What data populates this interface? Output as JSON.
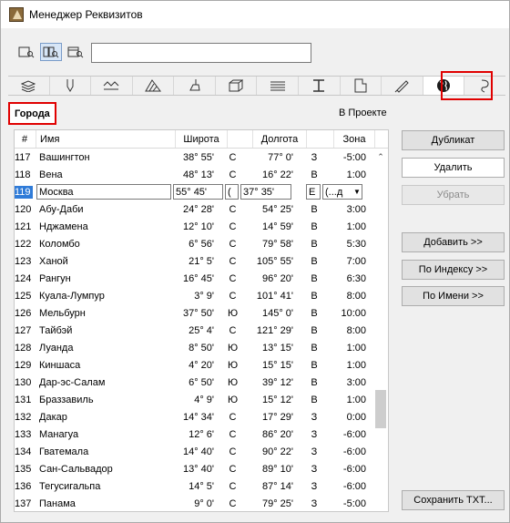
{
  "window": {
    "title": "Менеджер Реквизитов"
  },
  "search": {
    "value": "",
    "placeholder": ""
  },
  "view_buttons": [
    "list-view-icon",
    "grid-view-icon",
    "preview-view-icon"
  ],
  "tabs": [
    {
      "icon": "layers-icon"
    },
    {
      "icon": "pen-icon"
    },
    {
      "icon": "line-type-icon"
    },
    {
      "icon": "fill-icon"
    },
    {
      "icon": "brush-icon"
    },
    {
      "icon": "building-material-icon"
    },
    {
      "icon": "profile-icon"
    },
    {
      "icon": "beam-icon"
    },
    {
      "icon": "zone-category-icon"
    },
    {
      "icon": "pen-set-icon"
    },
    {
      "icon": "globe-icon"
    },
    {
      "icon": "mep-icon"
    }
  ],
  "section": {
    "title": "Города",
    "status": "В Проекте"
  },
  "table": {
    "headers": {
      "num": "#",
      "name": "Имя",
      "lat": "Широта",
      "lon": "Долгота",
      "zone": "Зона"
    },
    "editing_row": {
      "num": "119",
      "name": "Москва",
      "lat": "55° 45'",
      "ns": "(",
      "lon": "37° 35'",
      "ew": "E",
      "zone": "(...д"
    },
    "rows": [
      {
        "num": "117",
        "name": "Вашингтон",
        "lat": "38° 55'",
        "ns": "С",
        "lon": "77° 0'",
        "ew": "З",
        "zone": "-5:00"
      },
      {
        "num": "118",
        "name": "Вена",
        "lat": "48° 13'",
        "ns": "С",
        "lon": "16° 22'",
        "ew": "В",
        "zone": "1:00"
      },
      {
        "num": "119",
        "name": "Москва",
        "lat": "55° 45'",
        "ns": "(",
        "lon": "37° 35'",
        "ew": "E",
        "zone": "(...д"
      },
      {
        "num": "120",
        "name": "Абу-Даби",
        "lat": "24° 28'",
        "ns": "С",
        "lon": "54° 25'",
        "ew": "В",
        "zone": "3:00"
      },
      {
        "num": "121",
        "name": "Нджамена",
        "lat": "12° 10'",
        "ns": "С",
        "lon": "14° 59'",
        "ew": "В",
        "zone": "1:00"
      },
      {
        "num": "122",
        "name": "Коломбо",
        "lat": "6° 56'",
        "ns": "С",
        "lon": "79° 58'",
        "ew": "В",
        "zone": "5:30"
      },
      {
        "num": "123",
        "name": "Ханой",
        "lat": "21° 5'",
        "ns": "С",
        "lon": "105° 55'",
        "ew": "В",
        "zone": "7:00"
      },
      {
        "num": "124",
        "name": "Рангун",
        "lat": "16° 45'",
        "ns": "С",
        "lon": "96° 20'",
        "ew": "В",
        "zone": "6:30"
      },
      {
        "num": "125",
        "name": "Куала-Лумпур",
        "lat": "3° 9'",
        "ns": "С",
        "lon": "101° 41'",
        "ew": "В",
        "zone": "8:00"
      },
      {
        "num": "126",
        "name": "Мельбурн",
        "lat": "37° 50'",
        "ns": "Ю",
        "lon": "145° 0'",
        "ew": "В",
        "zone": "10:00"
      },
      {
        "num": "127",
        "name": "Тайбэй",
        "lat": "25° 4'",
        "ns": "С",
        "lon": "121° 29'",
        "ew": "В",
        "zone": "8:00"
      },
      {
        "num": "128",
        "name": "Луанда",
        "lat": "8° 50'",
        "ns": "Ю",
        "lon": "13° 15'",
        "ew": "В",
        "zone": "1:00"
      },
      {
        "num": "129",
        "name": "Киншаса",
        "lat": "4° 20'",
        "ns": "Ю",
        "lon": "15° 15'",
        "ew": "В",
        "zone": "1:00"
      },
      {
        "num": "130",
        "name": "Дар-эс-Салам",
        "lat": "6° 50'",
        "ns": "Ю",
        "lon": "39° 12'",
        "ew": "В",
        "zone": "3:00"
      },
      {
        "num": "131",
        "name": "Браззавиль",
        "lat": "4° 9'",
        "ns": "Ю",
        "lon": "15° 12'",
        "ew": "В",
        "zone": "1:00"
      },
      {
        "num": "132",
        "name": "Дакар",
        "lat": "14° 34'",
        "ns": "С",
        "lon": "17° 29'",
        "ew": "З",
        "zone": "0:00"
      },
      {
        "num": "133",
        "name": "Манагуа",
        "lat": "12° 6'",
        "ns": "С",
        "lon": "86° 20'",
        "ew": "З",
        "zone": "-6:00"
      },
      {
        "num": "134",
        "name": "Гватемала",
        "lat": "14° 40'",
        "ns": "С",
        "lon": "90° 22'",
        "ew": "З",
        "zone": "-6:00"
      },
      {
        "num": "135",
        "name": "Сан-Сальвадор",
        "lat": "13° 40'",
        "ns": "С",
        "lon": "89° 10'",
        "ew": "З",
        "zone": "-6:00"
      },
      {
        "num": "136",
        "name": "Тегусигальпа",
        "lat": "14° 5'",
        "ns": "С",
        "lon": "87° 14'",
        "ew": "З",
        "zone": "-6:00"
      },
      {
        "num": "137",
        "name": "Панама",
        "lat": "9° 0'",
        "ns": "С",
        "lon": "79° 25'",
        "ew": "З",
        "zone": "-5:00"
      }
    ]
  },
  "buttons": {
    "duplicate": "Дубликат",
    "delete": "Удалить",
    "remove": "Убрать",
    "add": "Добавить >>",
    "by_index": "По Индексу >>",
    "by_name": "По Имени >>",
    "save_txt": "Сохранить TXT..."
  }
}
